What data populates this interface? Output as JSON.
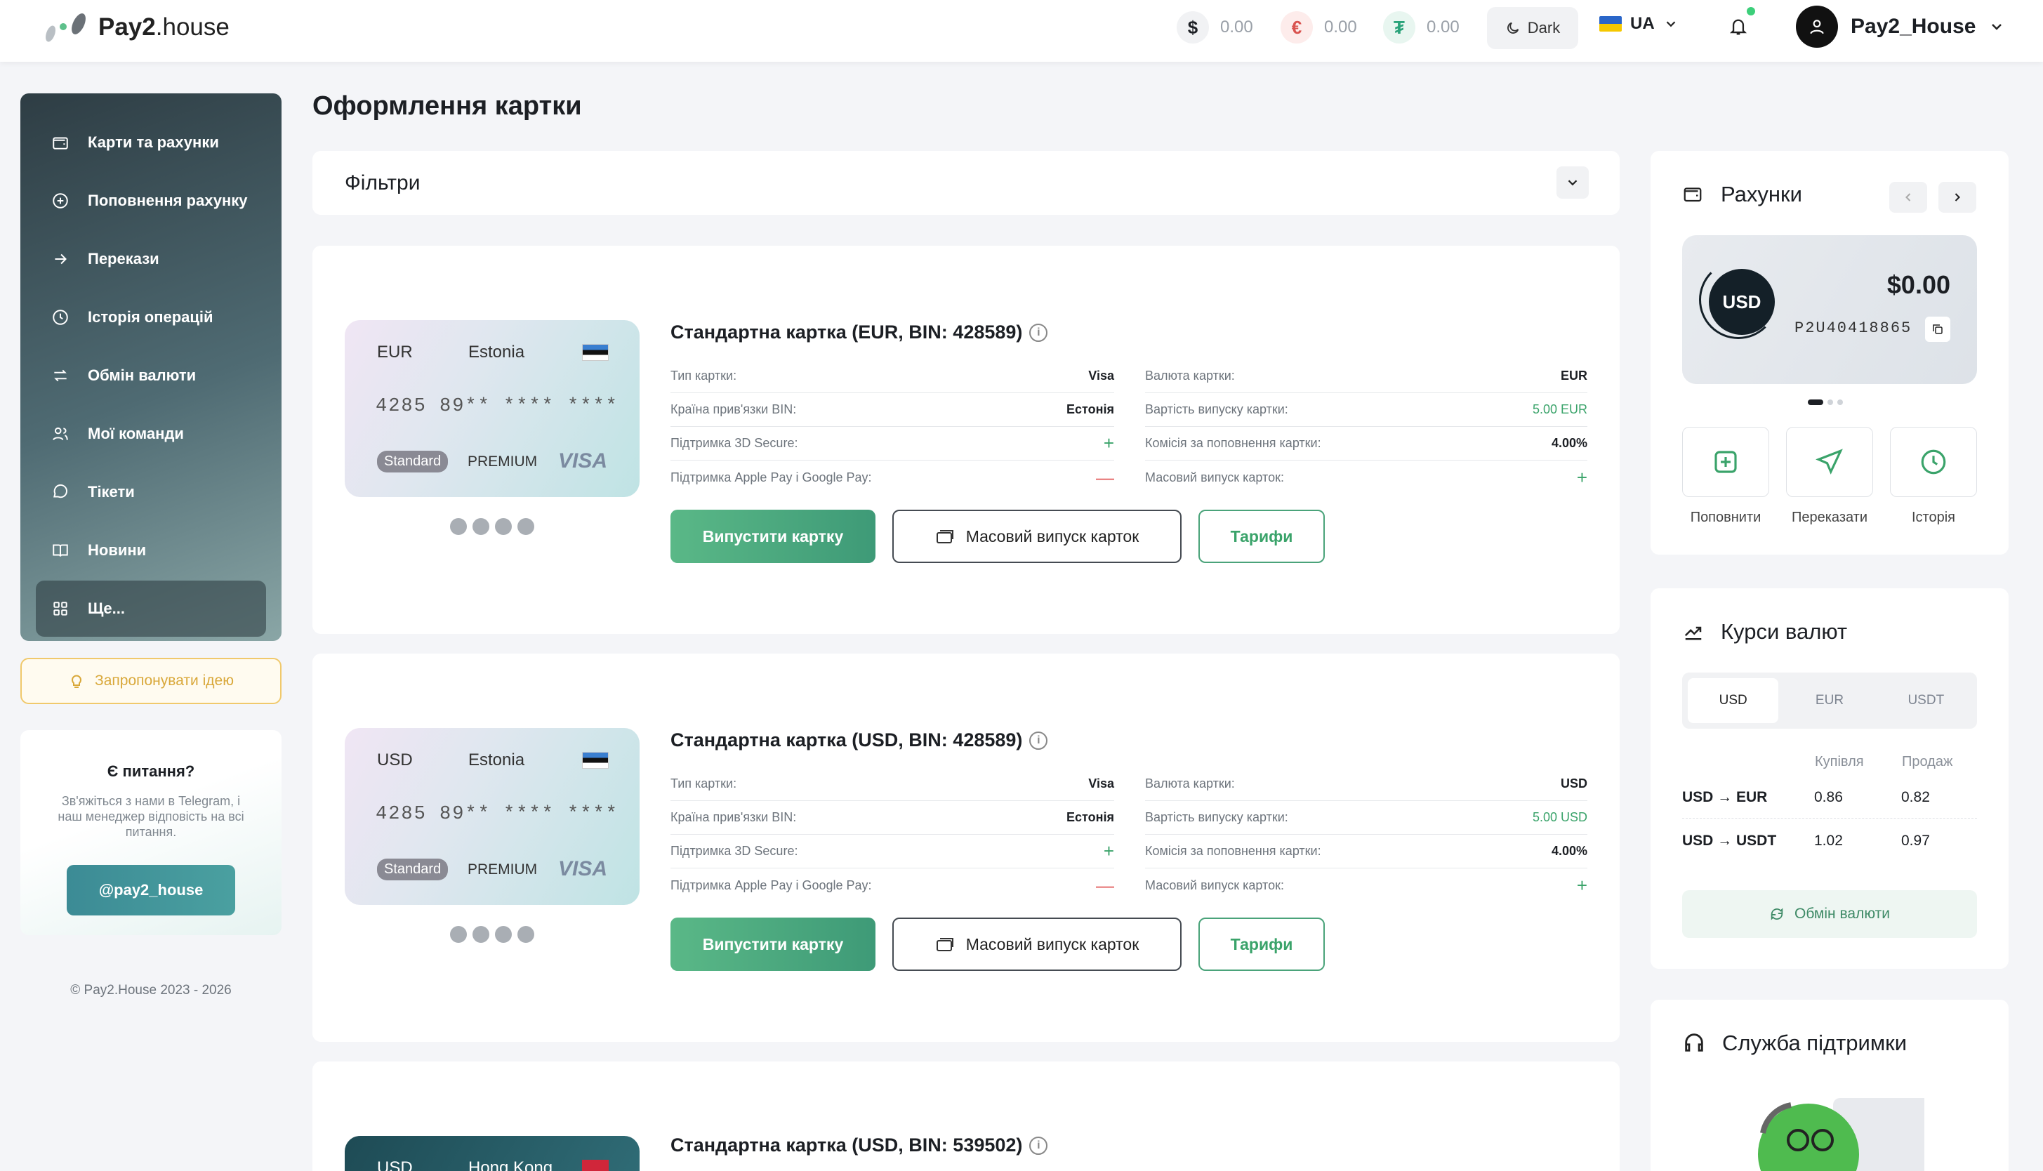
{
  "header": {
    "brand": "Pay2",
    "brand_suffix": ".house",
    "balances": [
      {
        "symbol": "$",
        "value": "0.00",
        "color": "#1c1f24",
        "bg": "#f1f2f4"
      },
      {
        "symbol": "€",
        "value": "0.00",
        "color": "#d9534f",
        "bg": "#fdeceb"
      },
      {
        "symbol": "₮",
        "value": "0.00",
        "color": "#2aa37a",
        "bg": "#e8f6f0"
      }
    ],
    "theme_label": "Dark",
    "lang": "UA",
    "user_name": "Pay2_House"
  },
  "sidebar": {
    "items": [
      {
        "label": "Карти та рахунки",
        "icon": "wallet-icon"
      },
      {
        "label": "Поповнення рахунку",
        "icon": "plus-circle-icon"
      },
      {
        "label": "Перекази",
        "icon": "arrow-right-icon"
      },
      {
        "label": "Історія операцій",
        "icon": "clock-icon"
      },
      {
        "label": "Обмін валюти",
        "icon": "exchange-icon"
      },
      {
        "label": "Мої команди",
        "icon": "users-icon"
      },
      {
        "label": "Тікети",
        "icon": "chat-icon"
      },
      {
        "label": "Новини",
        "icon": "book-icon"
      },
      {
        "label": "Ще...",
        "icon": "grid-icon"
      }
    ],
    "idea_label": "Запропонувати ідею",
    "help": {
      "title": "Є питання?",
      "text": "Зв'яжіться з нами в Telegram, і наш менеджер відповість на всі питання.",
      "button": "@pay2_house"
    },
    "copyright": "© Pay2.House 2023 - 2026"
  },
  "main": {
    "title": "Оформлення картки",
    "filters_label": "Фільтри",
    "cards": [
      {
        "title": "Стандартна картка (EUR, BIN: 428589)",
        "card_currency": "EUR",
        "card_country": "Estonia",
        "card_number": "4285 89** **** ****",
        "card_level": "Standard",
        "card_tier": "PREMIUM",
        "card_network": "VISA",
        "left": [
          {
            "label": "Тип картки:",
            "value": "Visa",
            "kind": "text"
          },
          {
            "label": "Країна прив'язки BIN:",
            "value": "Естонія",
            "kind": "text"
          },
          {
            "label": "Підтримка 3D Secure:",
            "value": "+",
            "kind": "plus"
          },
          {
            "label": "Підтримка Apple Pay і Google Pay:",
            "value": "—",
            "kind": "minus"
          }
        ],
        "right": [
          {
            "label": "Валюта картки:",
            "value": "EUR",
            "kind": "text"
          },
          {
            "label": "Вартість випуску картки:",
            "value": "5.00 EUR",
            "kind": "green"
          },
          {
            "label": "Комісія за поповнення картки:",
            "value": "4.00%",
            "kind": "text"
          },
          {
            "label": "Масовий випуск карток:",
            "value": "+",
            "kind": "plus"
          }
        ]
      },
      {
        "title": "Стандартна картка (USD, BIN: 428589)",
        "card_currency": "USD",
        "card_country": "Estonia",
        "card_number": "4285 89** **** ****",
        "card_level": "Standard",
        "card_tier": "PREMIUM",
        "card_network": "VISA",
        "left": [
          {
            "label": "Тип картки:",
            "value": "Visa",
            "kind": "text"
          },
          {
            "label": "Країна прив'язки BIN:",
            "value": "Естонія",
            "kind": "text"
          },
          {
            "label": "Підтримка 3D Secure:",
            "value": "+",
            "kind": "plus"
          },
          {
            "label": "Підтримка Apple Pay і Google Pay:",
            "value": "—",
            "kind": "minus"
          }
        ],
        "right": [
          {
            "label": "Валюта картки:",
            "value": "USD",
            "kind": "text"
          },
          {
            "label": "Вартість випуску картки:",
            "value": "5.00 USD",
            "kind": "green"
          },
          {
            "label": "Комісія за поповнення картки:",
            "value": "4.00%",
            "kind": "text"
          },
          {
            "label": "Масовий випуск карток:",
            "value": "+",
            "kind": "plus"
          }
        ]
      },
      {
        "title": "Стандартна картка (USD, BIN: 539502)",
        "card_currency": "USD",
        "card_country": "Hong Kong"
      }
    ],
    "btn_issue": "Випустити картку",
    "btn_mass": "Масовий випуск карток",
    "btn_tariffs": "Тарифи"
  },
  "accounts": {
    "title": "Рахунки",
    "currency": "USD",
    "amount": "$0.00",
    "account_number": "P2U40418865",
    "actions": [
      {
        "label": "Поповнити",
        "icon": "add-square-icon"
      },
      {
        "label": "Переказати",
        "icon": "send-icon"
      },
      {
        "label": "Історія",
        "icon": "clock-icon"
      }
    ]
  },
  "rates": {
    "title": "Курси валют",
    "tabs": [
      "USD",
      "EUR",
      "USDT"
    ],
    "active_tab": "USD",
    "col_buy": "Купівля",
    "col_sell": "Продаж",
    "rows": [
      {
        "pair": "USD → EUR",
        "buy": "0.86",
        "sell": "0.82"
      },
      {
        "pair": "USD → USDT",
        "buy": "1.02",
        "sell": "0.97"
      }
    ],
    "exchange_button": "Обмін валюти"
  },
  "support": {
    "title": "Служба підтримки"
  }
}
